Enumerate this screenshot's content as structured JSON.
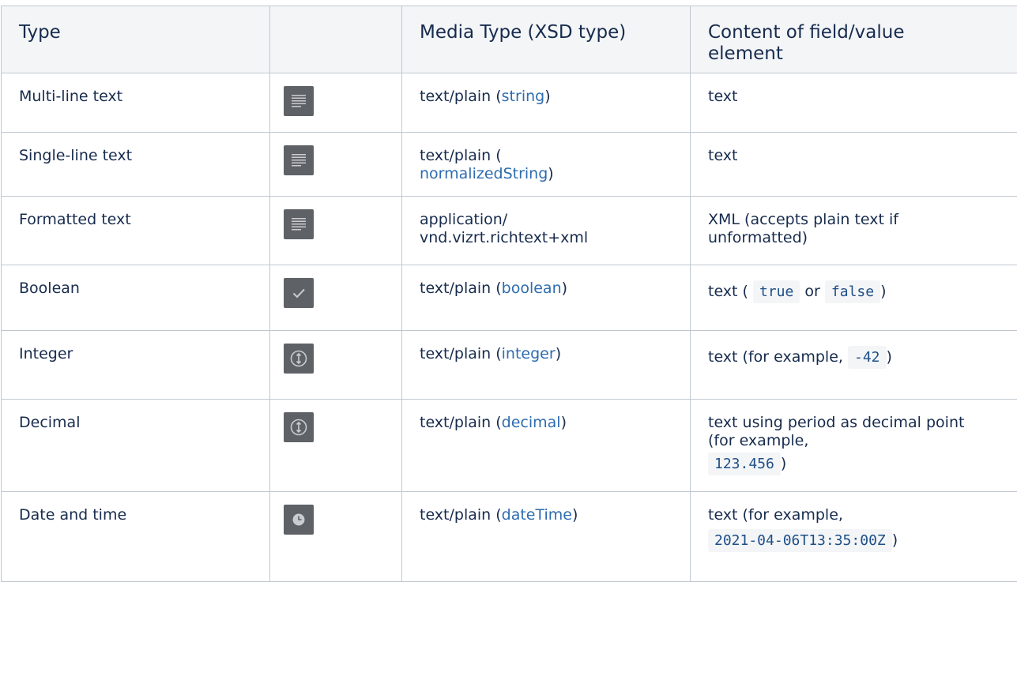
{
  "headers": {
    "type": "Type",
    "icon": "",
    "media_type": "Media Type (XSD type)",
    "content": "Content of field/value element"
  },
  "rows": [
    {
      "type": "Multi-line text",
      "icon": "text-lines-icon",
      "media_pre": "text/plain (",
      "media_link": "string",
      "media_post": ")",
      "content": "text"
    },
    {
      "type": "Single-line text",
      "icon": "text-lines-icon",
      "media_pre": "text/plain (",
      "media_link": "normalizedString",
      "media_post": ")",
      "content": "text"
    },
    {
      "type": "Formatted text",
      "icon": "text-lines-icon",
      "media_text": "application/ vnd.vizrt.richtext+xml",
      "content": "XML (accepts plain text if unformatted)"
    },
    {
      "type": "Boolean",
      "icon": "checkmark-icon",
      "media_pre": "text/plain (",
      "media_link": "boolean",
      "media_post": ")",
      "content_pre": "text (",
      "code1": "true",
      "content_mid": "or",
      "code2": "false",
      "content_post": ")"
    },
    {
      "type": "Integer",
      "icon": "stepper-icon",
      "media_pre": "text/plain (",
      "media_link": "integer",
      "media_post": ")",
      "content_pre": "text (for example,",
      "code": "-42",
      "content_post": ")"
    },
    {
      "type": "Decimal",
      "icon": "stepper-icon",
      "media_pre": "text/plain (",
      "media_link": "decimal",
      "media_post": ")",
      "content_pre": "text using period as decimal point (for example,",
      "code": "123.456",
      "content_post": ")"
    },
    {
      "type": "Date and time",
      "icon": "clock-icon",
      "media_pre": "text/plain (",
      "media_link": "dateTime",
      "media_post": ")",
      "content_pre": "text (for example,",
      "code": "2021-04-06T13:35:00Z",
      "content_post": ")"
    }
  ],
  "colors": {
    "header_bg": "#f4f5f7",
    "border": "#c1c7d0",
    "link": "#2e6cb0",
    "icon_bg": "#5e6166"
  }
}
